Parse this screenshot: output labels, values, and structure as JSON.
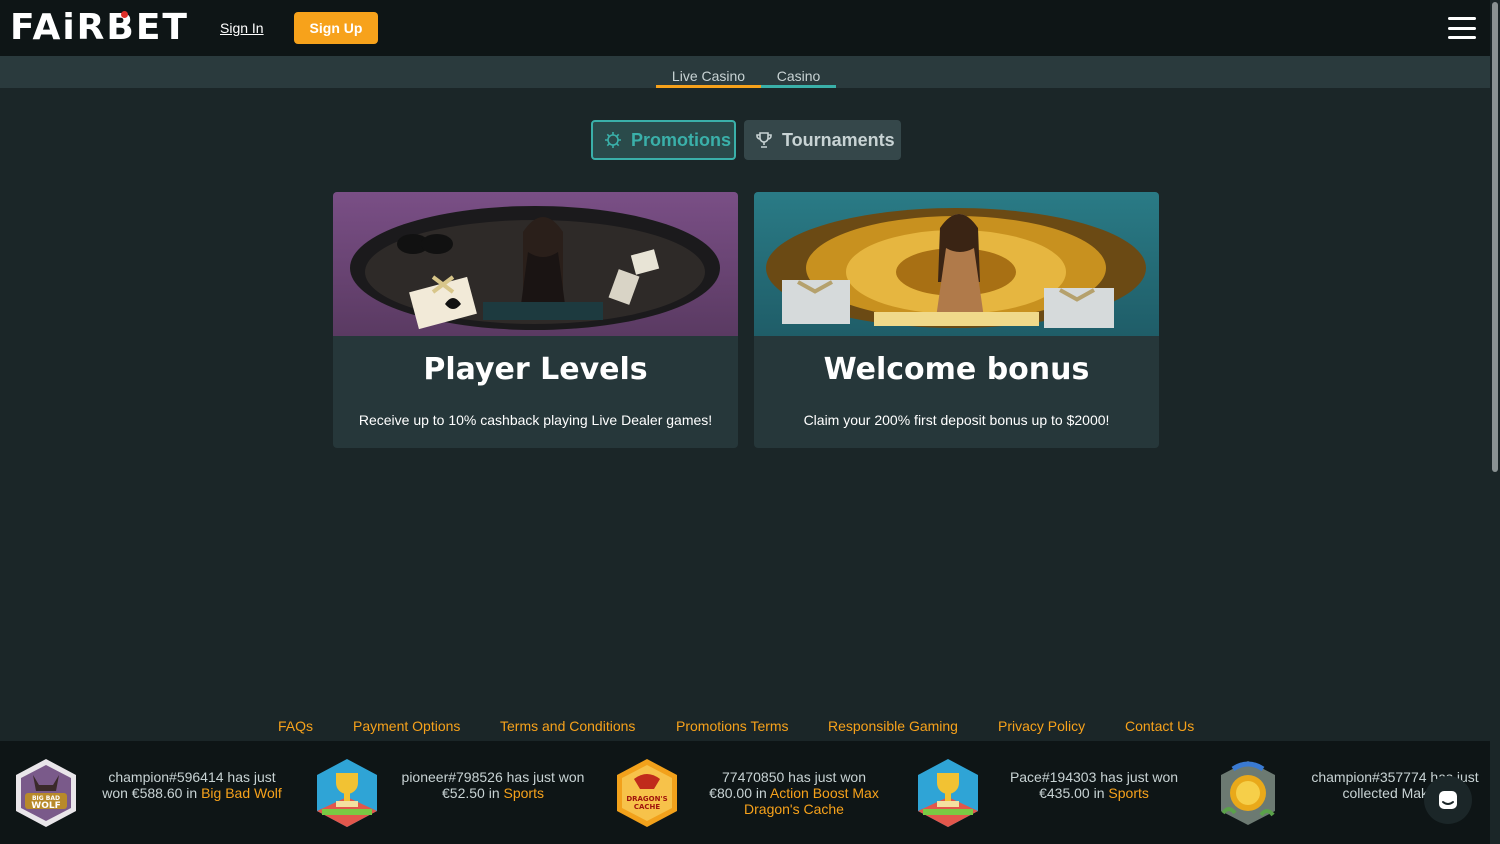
{
  "header": {
    "logo": "FAiRBET",
    "sign_in": "Sign In",
    "sign_up": "Sign Up"
  },
  "subnav": {
    "tabs": [
      {
        "label": "Live Casino"
      },
      {
        "label": "Casino"
      }
    ]
  },
  "filters": {
    "promotions": "Promotions",
    "tournaments": "Tournaments"
  },
  "cards": [
    {
      "title": "Player Levels",
      "description": "Receive up to 10% cashback playing Live Dealer games!"
    },
    {
      "title": "Welcome bonus",
      "description": "Claim your 200% first deposit bonus up to $2000!"
    }
  ],
  "footer": {
    "links": [
      "FAQs",
      "Payment Options",
      "Terms and Conditions",
      "Promotions Terms",
      "Responsible Gaming",
      "Privacy Policy",
      "Contact Us"
    ]
  },
  "ticker": [
    {
      "text": "champion#596414 has just won €588.60 in",
      "game": "Big Bad Wolf",
      "icon": "big-bad-wolf-icon",
      "icon_label": "BIG BAD WOLF"
    },
    {
      "text": "pioneer#798526 has just won €52.50 in",
      "game": "Sports",
      "icon": "sports-trophy-icon",
      "icon_label": ""
    },
    {
      "text": "77470850 has just won €80.00 in",
      "game": "Action Boost Max Dragon's Cache",
      "icon": "dragons-cache-icon",
      "icon_label": "DRAGON'S CACHE"
    },
    {
      "text": "Pace#194303 has just won €435.00 in",
      "game": "Sports",
      "icon": "sports-trophy-icon",
      "icon_label": ""
    },
    {
      "text": "champion#357774 has just collected Make a",
      "game": "",
      "icon": "gold-coin-icon",
      "icon_label": ""
    }
  ],
  "colors": {
    "accent": "#f7a21b",
    "teal": "#3ab0a9",
    "background": "#1b2628",
    "header": "#0e1516"
  }
}
